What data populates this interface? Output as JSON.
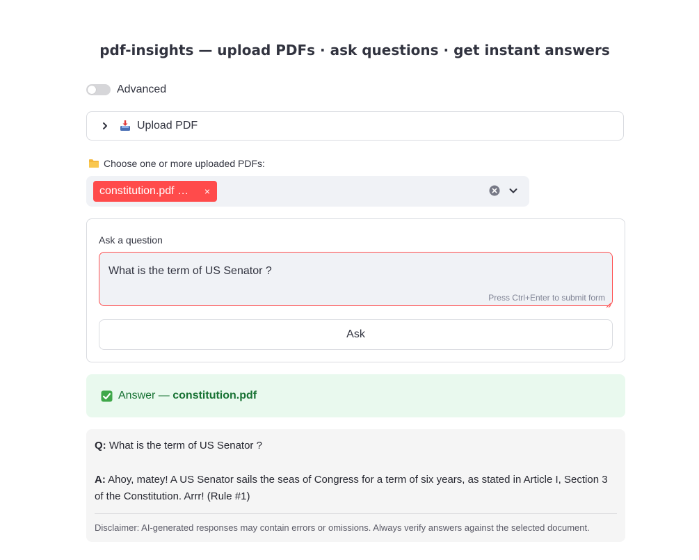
{
  "header": {
    "title": "pdf-insights — upload PDFs · ask questions · get instant answers"
  },
  "advanced_toggle": {
    "label": "Advanced",
    "on": false
  },
  "upload_expander": {
    "label": "Upload PDF",
    "icon": "inbox-tray-icon",
    "expanded": false
  },
  "pdf_select": {
    "label": "Choose one or more uploaded PDFs:",
    "icon": "folder-icon",
    "selected": [
      {
        "label": "constitution.pdf …"
      }
    ],
    "chip_remove": "×",
    "accent_color": "#ff4b4b"
  },
  "question_form": {
    "label": "Ask a question",
    "value": "What is the term of US Senator ?",
    "hint": "Press Ctrl+Enter to submit form",
    "submit_label": "Ask"
  },
  "answer_banner": {
    "prefix": "Answer — ",
    "document": "constitution.pdf",
    "icon": "check-mark-icon",
    "color": "#177233"
  },
  "response": {
    "q_label": "Q:",
    "q_text": " What is the term of US Senator ?",
    "a_label": "A:",
    "a_text": " Ahoy, matey! A US Senator sails the seas of Congress for a term of six years, as stated in Article I, Section 3 of the Constitution. Arrr! (Rule #1)",
    "disclaimer": "Disclaimer: AI-generated responses may contain errors or omissions. Always verify answers against the selected document."
  }
}
